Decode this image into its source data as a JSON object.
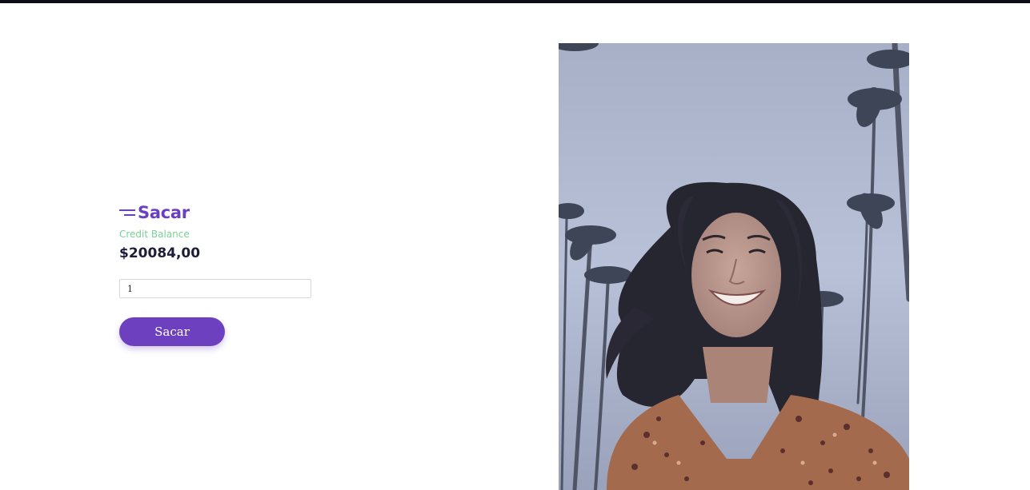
{
  "header": {
    "title_icon": "menu-lines-icon",
    "title": "Sacar"
  },
  "balance": {
    "label": "Credit Balance",
    "value": "$20084,00"
  },
  "form": {
    "amount_value": "1",
    "submit_label": "Sacar"
  },
  "colors": {
    "accent": "#6c40bf",
    "balance_label": "#7ad197",
    "balance_value": "#1d1d3a",
    "top_bar": "#0b0d17"
  },
  "hero": {
    "description_icon": "smiling-woman-palm-trees-photo"
  }
}
